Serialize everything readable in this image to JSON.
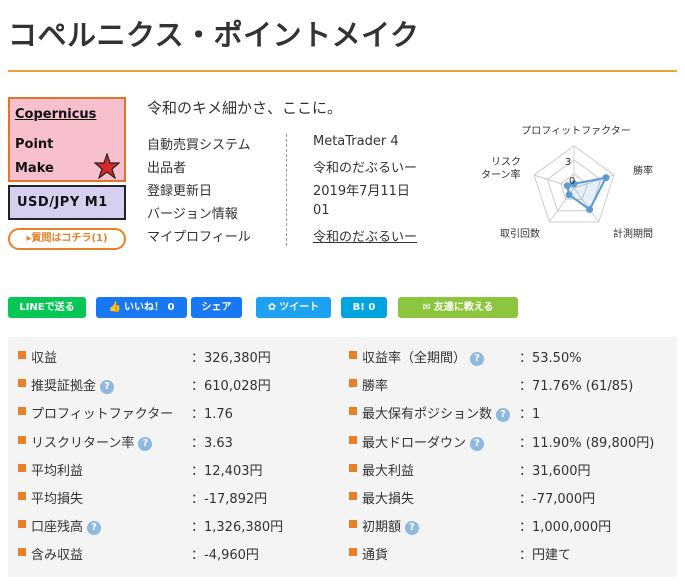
{
  "title": "コペルニクス・ポイントメイク",
  "product_image": {
    "line1": "Copernicus",
    "line2": "Point",
    "line3": "Make",
    "pair_label": "USD/JPY  M1"
  },
  "question_button": "▸質問はコチラ(1)",
  "catchphrase": "令和のキメ細かさ、ここに。",
  "info": [
    {
      "label": "自動売買システム",
      "value": "MetaTrader 4",
      "link": false
    },
    {
      "label": "出品者",
      "value": "令和のだぶるいー",
      "link": false
    },
    {
      "label": "登録更新日",
      "value": "2019年7月11日",
      "link": false
    },
    {
      "label": "バージョン情報",
      "value": "01",
      "link": false
    },
    {
      "label": "マイプロフィール",
      "value": "令和のだぶるいー",
      "link": true
    }
  ],
  "radar": {
    "axes": [
      "プロフィットファクター",
      "勝率",
      "計測期間",
      "取引回数",
      "リスク\nターン率"
    ],
    "axis_label_top": "プロフィットファクター",
    "axis_label_right": "勝率",
    "axis_label_bottom_right": "計測期間",
    "axis_label_bottom_left": "取引回数",
    "axis_label_left_1": "リスク",
    "axis_label_left_2": "ターン率",
    "scale_max": "3",
    "scale_min": "0",
    "values": [
      0.3,
      2.4,
      1.9,
      0.6,
      0.5
    ],
    "color": "#5b9bd5"
  },
  "share_buttons": {
    "line": "LINEで送る",
    "like": "いいね！ 0",
    "share": "シェア",
    "tweet": "ツイート",
    "hatena_b": "B!",
    "hatena_count": "0",
    "friend": "友達に教える"
  },
  "stats_left": [
    {
      "label": "収益",
      "help": false,
      "value": "：326,380円"
    },
    {
      "label": "推奨証拠金",
      "help": true,
      "value": "：610,028円"
    },
    {
      "label": "プロフィットファクター",
      "help": false,
      "value": "：1.76"
    },
    {
      "label": "リスクリターン率",
      "help": true,
      "value": "：3.63"
    },
    {
      "label": "平均利益",
      "help": false,
      "value": "：12,403円"
    },
    {
      "label": "平均損失",
      "help": false,
      "value": "：-17,892円"
    },
    {
      "label": "口座残高",
      "help": true,
      "value": "：1,326,380円"
    },
    {
      "label": "含み収益",
      "help": false,
      "value": "：-4,960円"
    }
  ],
  "stats_right": [
    {
      "label": "収益率（全期間）",
      "help": true,
      "value": "：53.50%"
    },
    {
      "label": "勝率",
      "help": false,
      "value": "：71.76% (61/85)"
    },
    {
      "label": "最大保有ポジション数",
      "help": true,
      "value": "：1"
    },
    {
      "label": "最大ドローダウン",
      "help": true,
      "value": "：11.90% (89,800円)"
    },
    {
      "label": "最大利益",
      "help": false,
      "value": "：31,600円"
    },
    {
      "label": "最大損失",
      "help": false,
      "value": "：-77,000円"
    },
    {
      "label": "初期額",
      "help": true,
      "value": "：1,000,000円"
    },
    {
      "label": "通貨",
      "help": false,
      "value": "：円建て"
    }
  ],
  "help_glyph": "?",
  "colors": {
    "accent": "#e8802a",
    "rule": "#e8a33a",
    "line_green": "#06c755",
    "facebook": "#1877f2",
    "twitter": "#1da1f2",
    "hatena": "#00a4de",
    "friend_green": "#8cc63f"
  }
}
